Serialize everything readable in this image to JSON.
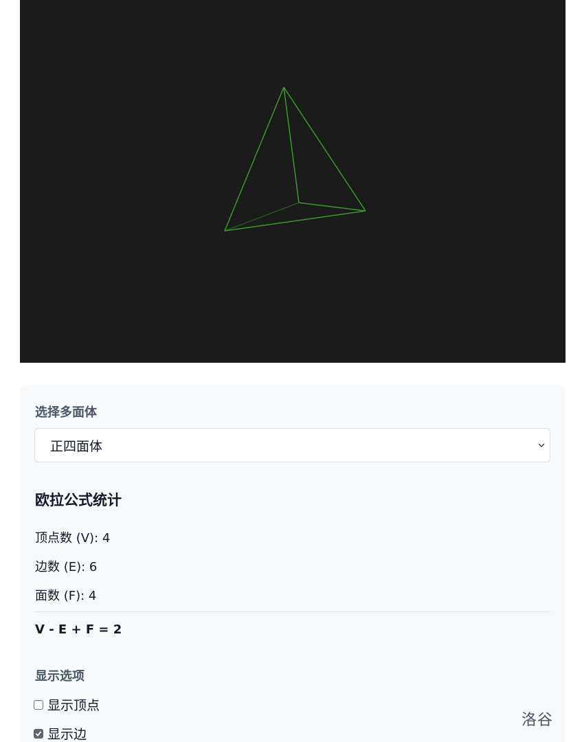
{
  "viewer": {
    "background": "#1b1b1b",
    "edge_color": "#3a9a2a",
    "hidden_edge_color": "#23551c"
  },
  "selector": {
    "label": "选择多面体",
    "selected": "正四面体"
  },
  "stats": {
    "title": "欧拉公式统计",
    "vertices": "顶点数 (V): 4",
    "edges": "边数 (E): 6",
    "faces": "面数 (F): 4",
    "formula": "V - E + F = 2"
  },
  "display": {
    "label": "显示选项",
    "show_vertices": {
      "label": "显示顶点",
      "checked": false
    },
    "show_edges": {
      "label": "显示边",
      "checked": true
    }
  },
  "watermark": "洛谷"
}
